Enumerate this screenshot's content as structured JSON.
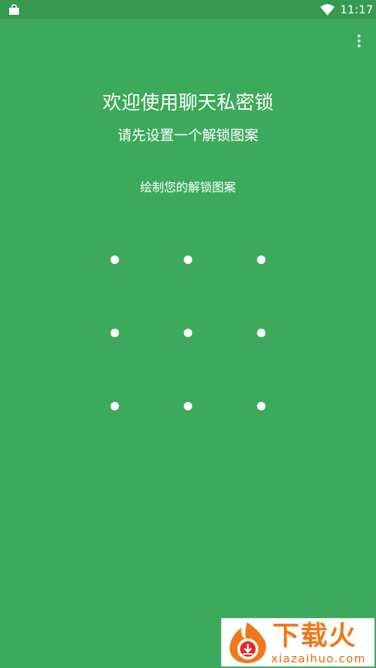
{
  "status_bar": {
    "time": "11:17",
    "left_icon": "shopping-bag-icon",
    "wifi_icon": "wifi-icon"
  },
  "toolbar": {
    "menu_icon": "more-vert-icon"
  },
  "main": {
    "title": "欢迎使用聊天私密锁",
    "subtitle": "请先设置一个解锁图案",
    "instruction": "绘制您的解锁图案"
  },
  "pattern": {
    "rows": 3,
    "cols": 3
  },
  "watermark": {
    "brand": "下载火",
    "domain": "xiazaihuo.com"
  },
  "colors": {
    "background": "#3da95c",
    "status_bar": "#379a53",
    "dot": "#ffffff",
    "watermark_orange": "#ef7818"
  }
}
